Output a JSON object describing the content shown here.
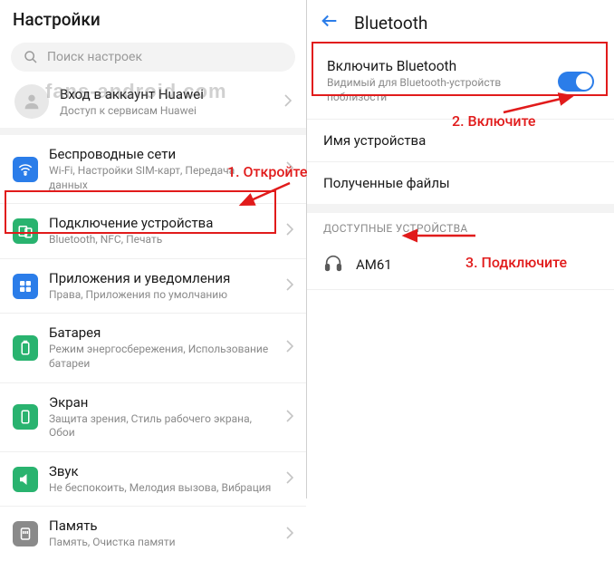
{
  "left": {
    "header": "Настройки",
    "search_placeholder": "Поиск настроек",
    "account": {
      "title": "Вход в аккаунт Huawei",
      "sub": "Доступ к сервисам Huawei"
    },
    "items": [
      {
        "title": "Беспроводные сети",
        "sub": "Wi-Fi, Настройки SIM-карт, Передача данных"
      },
      {
        "title": "Подключение устройства",
        "sub": "Bluetooth, NFC, Печать"
      },
      {
        "title": "Приложения и уведомления",
        "sub": "Права, Приложения по умолчанию"
      },
      {
        "title": "Батарея",
        "sub": "Режим энергосбережения, Использование батареи"
      },
      {
        "title": "Экран",
        "sub": "Защита зрения, Стиль рабочего экрана, Обои"
      },
      {
        "title": "Звук",
        "sub": "Не беспокоить, Мелодия вызова, Вибрация"
      },
      {
        "title": "Память",
        "sub": "Память, Очистка памяти"
      }
    ]
  },
  "right": {
    "title": "Bluetooth",
    "enable": {
      "title": "Включить Bluetooth",
      "sub": "Видимый для Bluetooth-устройств поблизости"
    },
    "rows": [
      {
        "title": "Имя устройства"
      },
      {
        "title": "Полученные файлы"
      }
    ],
    "section_label": "ДОСТУПНЫЕ УСТРОЙСТВА",
    "devices": [
      {
        "name": "AM61"
      }
    ]
  },
  "annotations": {
    "step1": "1. Откройте",
    "step2": "2. Включите",
    "step3": "3. Подключите"
  },
  "watermark": "fans-android.com",
  "colors": {
    "wifi": "#2b7de9",
    "device": "#29b36f",
    "apps": "#2b7de9",
    "battery": "#29b36f",
    "screen": "#29b36f",
    "sound": "#29b36f",
    "storage": "#8a8a8a"
  }
}
